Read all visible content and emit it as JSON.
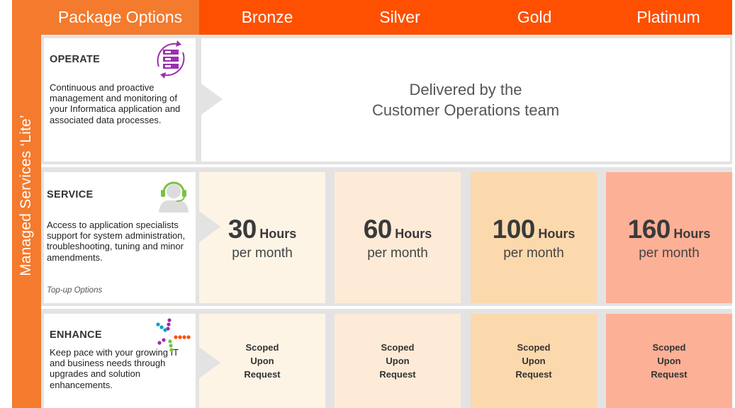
{
  "side_label": "Managed Services ‘Lite’",
  "header": {
    "package_label": "Package Options",
    "tiers": [
      "Bronze",
      "Silver",
      "Gold",
      "Platinum"
    ]
  },
  "operate": {
    "title": "OPERATE",
    "description": "Continuous and proactive management and monitoring of your Informatica application and associated data processes.",
    "delivery_line1": "Delivered by the",
    "delivery_line2": "Customer Operations team",
    "icon": "server-cycle-icon"
  },
  "service": {
    "title": "SERVICE",
    "description": "Access to application specialists support for system administration, troubleshooting, tuning and minor amendments.",
    "note": "Top-up Options",
    "icon": "headset-support-icon",
    "cells": [
      {
        "hours": "30",
        "unit": "Hours",
        "sub": "per month"
      },
      {
        "hours": "60",
        "unit": "Hours",
        "sub": "per month"
      },
      {
        "hours": "100",
        "unit": "Hours",
        "sub": "per month"
      },
      {
        "hours": "160",
        "unit": "Hours",
        "sub": "per month"
      }
    ]
  },
  "enhance": {
    "title": "ENHANCE",
    "description": "Keep pace with your growing IT and business needs through upgrades and solution enhancements.",
    "icon": "dots-burst-icon",
    "cells": [
      {
        "line1": "Scoped",
        "line2": "Upon",
        "line3": "Request"
      },
      {
        "line1": "Scoped",
        "line2": "Upon",
        "line3": "Request"
      },
      {
        "line1": "Scoped",
        "line2": "Upon",
        "line3": "Request"
      },
      {
        "line1": "Scoped",
        "line2": "Upon",
        "line3": "Request"
      }
    ]
  },
  "colors": {
    "header_orange": "#fe5000",
    "side_orange": "#f47a2d",
    "bronze": "#fdf4e6",
    "silver": "#fdebd7",
    "gold": "#fcd9ad",
    "platinum": "#fcb096"
  }
}
